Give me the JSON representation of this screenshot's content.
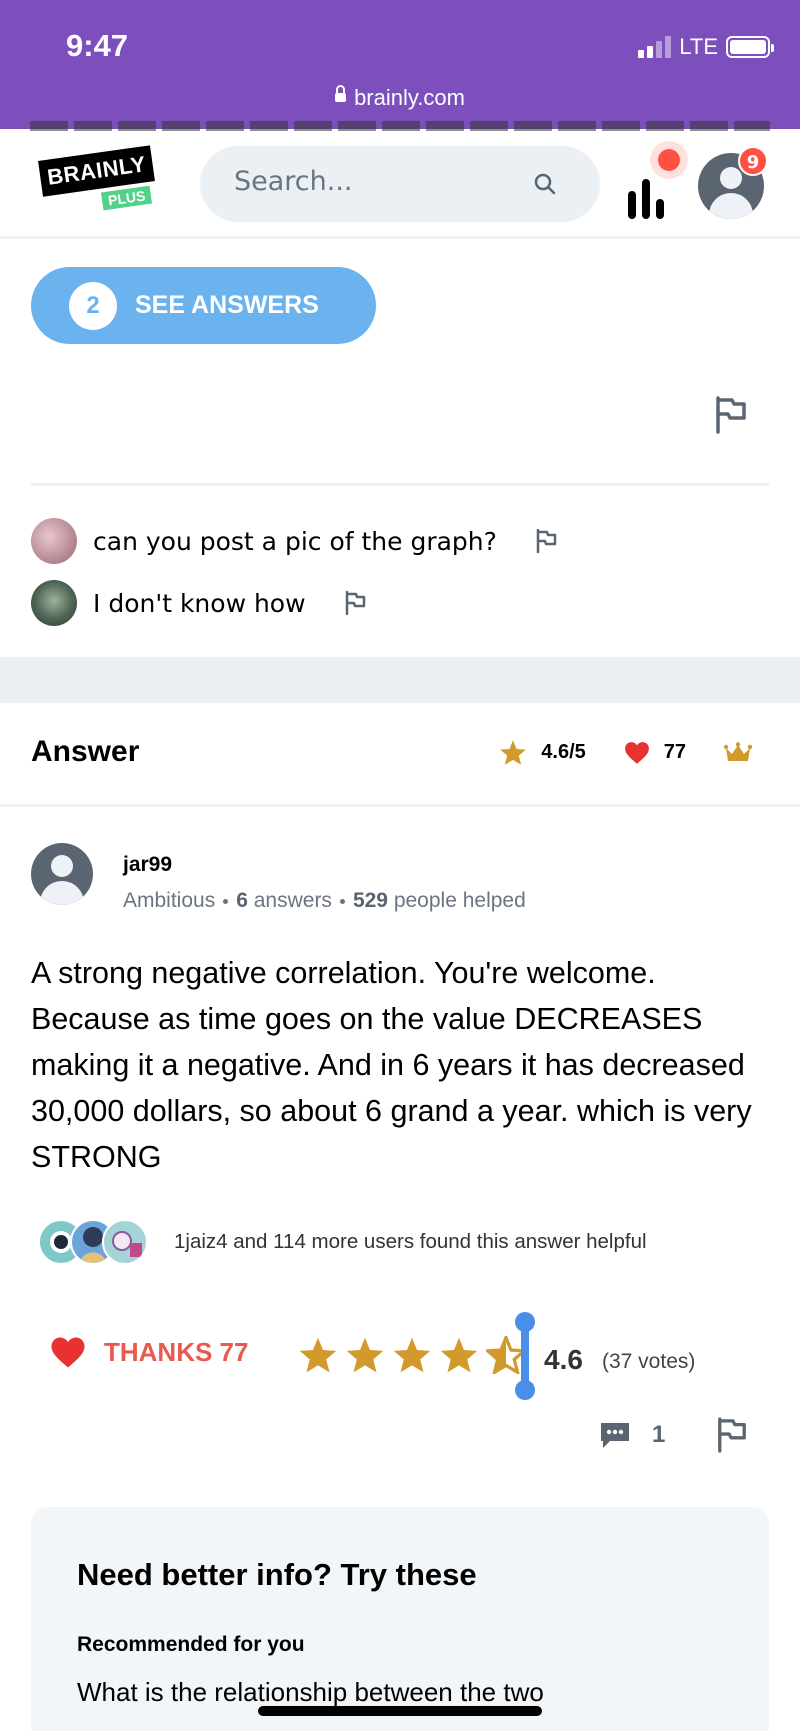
{
  "status_bar": {
    "time": "9:47",
    "network": "LTE",
    "url": "brainly.com"
  },
  "header": {
    "logo_text": "BRAINLY",
    "logo_badge": "PLUS",
    "search_placeholder": "Search...",
    "notification_count": "9",
    "colors": {
      "brand_purple": "#7c4fbd",
      "notification_red": "#ff5043"
    }
  },
  "question": {
    "see_answers_count": "2",
    "see_answers_label": "SEE ANSWERS",
    "comments": [
      {
        "text": "can you post a pic of the graph?"
      },
      {
        "text": "I don't know how"
      }
    ]
  },
  "answer_section": {
    "title": "Answer",
    "rating": "4.6/5",
    "thanks_count": "77"
  },
  "answer": {
    "author": "jar99",
    "rank": "Ambitious",
    "answers_count": "6",
    "answers_label": "answers",
    "helped_count": "529",
    "helped_label": "people helped",
    "text": "A strong negative correlation. You're welcome. Because as time goes on the value DECREASES making it a negative. And in  6 years it has decreased 30,000 dollars, so about 6 grand a year. which is very STRONG",
    "helpful_text": "1jaiz4 and 114 more users found this answer helpful",
    "thanks_label": "THANKS 77",
    "rating_value": "4.6",
    "rating_fraction": 0.92,
    "votes": "(37 votes)",
    "comment_count": "1"
  },
  "recommendations": {
    "title": "Need better info? Try these",
    "subtitle": "Recommended for you",
    "first_item": "What is the relationship between the two"
  }
}
